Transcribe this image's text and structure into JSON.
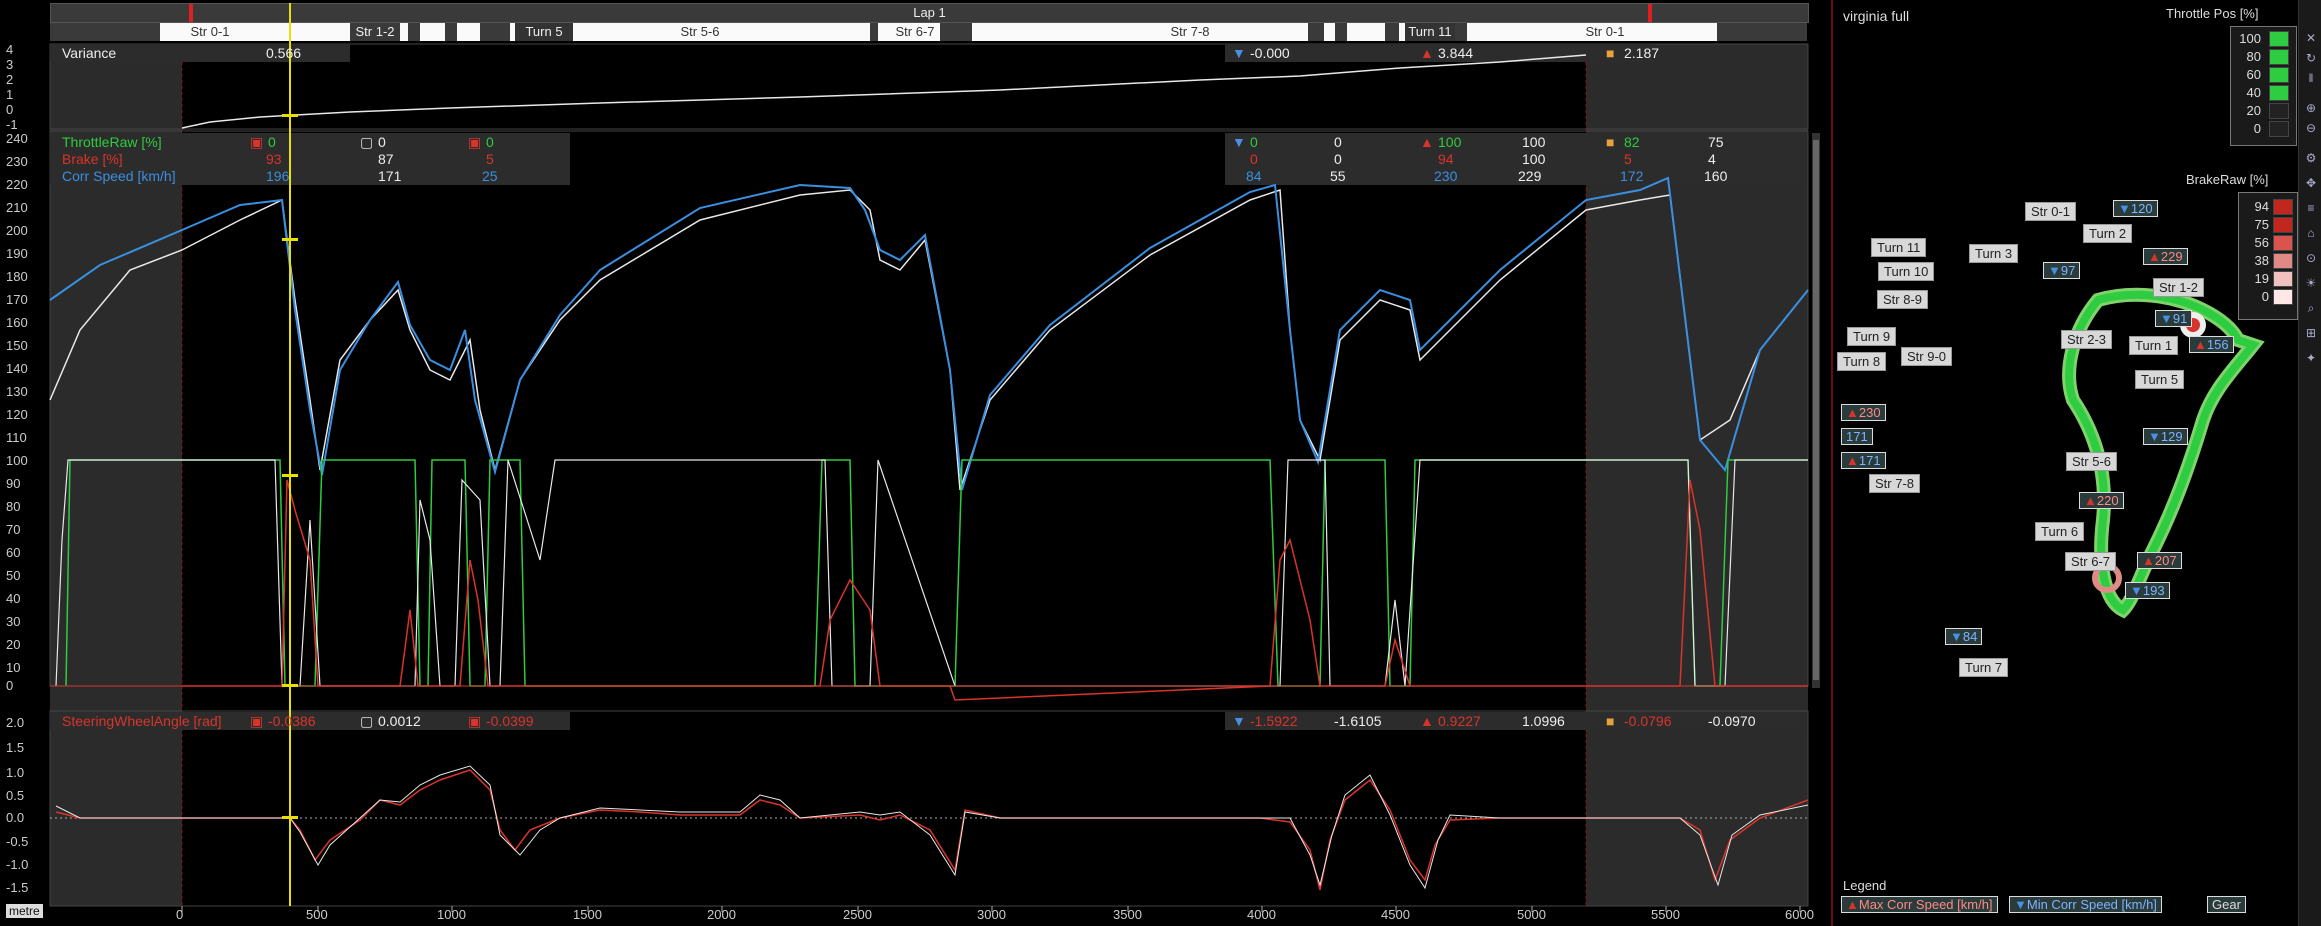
{
  "lap": {
    "label": "Lap 1"
  },
  "segments": [
    {
      "label": "Str 0-1"
    },
    {
      "label": "Str 1-2"
    },
    {
      "label": "Turn 5"
    },
    {
      "label": "Str 5-6"
    },
    {
      "label": "Str 6-7"
    },
    {
      "label": "Str 7-8"
    },
    {
      "label": "Turn 11"
    },
    {
      "label": "Str 0-1"
    }
  ],
  "variance_panel": {
    "name": "Variance",
    "value": "0.566",
    "stats": [
      {
        "icon": "down-triangle",
        "value": "-0.000",
        "color": "#4a90e2"
      },
      {
        "icon": "up-triangle",
        "value": "3.844",
        "color": "#d9342b"
      },
      {
        "icon": "square",
        "value": "2.187",
        "color": "#e8a23a"
      }
    ],
    "y_ticks": [
      "4",
      "3",
      "2",
      "1",
      "0",
      "-1"
    ]
  },
  "main_panel": {
    "channels": [
      {
        "name": "ThrottleRaw [%]",
        "color": "#2ecc40",
        "cursor_a": "0",
        "cursor_b": "0",
        "delta": "0",
        "min": "0",
        "min2": "0",
        "max": "100",
        "max2": "100",
        "avg": "82",
        "avg2": "75"
      },
      {
        "name": "Brake [%]",
        "color": "#d9342b",
        "cursor_a": "93",
        "cursor_b": "87",
        "delta": "5",
        "min": "0",
        "min2": "0",
        "max": "94",
        "max2": "100",
        "avg": "5",
        "avg2": "4"
      },
      {
        "name": "Corr Speed [km/h]",
        "color": "#3a8fe0",
        "cursor_a": "196",
        "cursor_b": "171",
        "delta": "25",
        "min": "84",
        "min2": "55",
        "max": "230",
        "max2": "229",
        "avg": "172",
        "avg2": "160"
      }
    ],
    "y_ticks": [
      "240",
      "230",
      "220",
      "210",
      "200",
      "190",
      "180",
      "170",
      "160",
      "150",
      "140",
      "130",
      "120",
      "110",
      "100",
      "90",
      "80",
      "70",
      "60",
      "50",
      "40",
      "30",
      "20",
      "10",
      "0"
    ]
  },
  "steer_panel": {
    "name": "SteeringWheelAngle [rad]",
    "color": "#d9342b",
    "cursor_a": "-0.0386",
    "cursor_b": "0.0012",
    "delta": "-0.0399",
    "min": "-1.5922",
    "min2": "-1.6105",
    "max": "0.9227",
    "max2": "1.0996",
    "avg": "-0.0796",
    "avg2": "-0.0970",
    "y_ticks": [
      "2.0",
      "1.5",
      "1.0",
      "0.5",
      "0.0",
      "-0.5",
      "-1.0",
      "-1.5"
    ]
  },
  "x_axis": {
    "unit_label": "metre",
    "ticks": [
      "0",
      "500",
      "1000",
      "1500",
      "2000",
      "2500",
      "3000",
      "3500",
      "4000",
      "4500",
      "5000",
      "5500",
      "6000"
    ]
  },
  "track_map": {
    "title": "virginia full",
    "throttle_scale": {
      "title": "Throttle Pos [%]",
      "values": [
        "100",
        "80",
        "60",
        "40",
        "20",
        "0"
      ],
      "colors": [
        "#2ecc40",
        "#2ecc40",
        "#2ecc40",
        "#2ecc40",
        "#222",
        "#222"
      ]
    },
    "brake_scale": {
      "title": "BrakeRaw [%]",
      "values": [
        "94",
        "75",
        "56",
        "38",
        "19",
        "0"
      ],
      "colors": [
        "#c1271f",
        "#c1271f",
        "#d9534f",
        "#e08a85",
        "#f0c2bf",
        "#fde8e6"
      ]
    },
    "labels": [
      {
        "text": "Str 0-1"
      },
      {
        "text": "Turn 2"
      },
      {
        "text": "Turn 11"
      },
      {
        "text": "Turn 3"
      },
      {
        "text": "Turn 10"
      },
      {
        "text": "Str 1-2"
      },
      {
        "text": "Str 8-9"
      },
      {
        "text": "Str 2-3"
      },
      {
        "text": "Turn 1"
      },
      {
        "text": "Turn 9"
      },
      {
        "text": "Turn 8"
      },
      {
        "text": "Str 9-0"
      },
      {
        "text": "Turn 5"
      },
      {
        "text": "Str 5-6"
      },
      {
        "text": "Str 7-8"
      },
      {
        "text": "Turn 6"
      },
      {
        "text": "Str 6-7"
      },
      {
        "text": "Turn 7"
      }
    ],
    "values": [
      {
        "text": "120",
        "kind": "min"
      },
      {
        "text": "229",
        "kind": "max"
      },
      {
        "text": "97",
        "kind": "min"
      },
      {
        "text": "91",
        "kind": "min"
      },
      {
        "text": "156",
        "kind": "max"
      },
      {
        "text": "230",
        "kind": "max"
      },
      {
        "text": "171",
        "kind": "min"
      },
      {
        "text": "171",
        "kind": "max"
      },
      {
        "text": "129",
        "kind": "min"
      },
      {
        "text": "220",
        "kind": "max"
      },
      {
        "text": "207",
        "kind": "max"
      },
      {
        "text": "193",
        "kind": "min"
      },
      {
        "text": "84",
        "kind": "min"
      }
    ],
    "legend": {
      "title": "Legend",
      "items": [
        {
          "text": "Max Corr Speed [km/h]",
          "icon": "up-triangle-red"
        },
        {
          "text": "Min Corr Speed [km/h]",
          "icon": "down-triangle-blue"
        },
        {
          "text": "Gear",
          "icon": "none"
        }
      ]
    }
  },
  "colors": {
    "throttle": "#2ecc40",
    "brake": "#d9342b",
    "speed": "#3a8fe0",
    "reference": "#e8e8e8",
    "cursor": "#e8e000"
  }
}
